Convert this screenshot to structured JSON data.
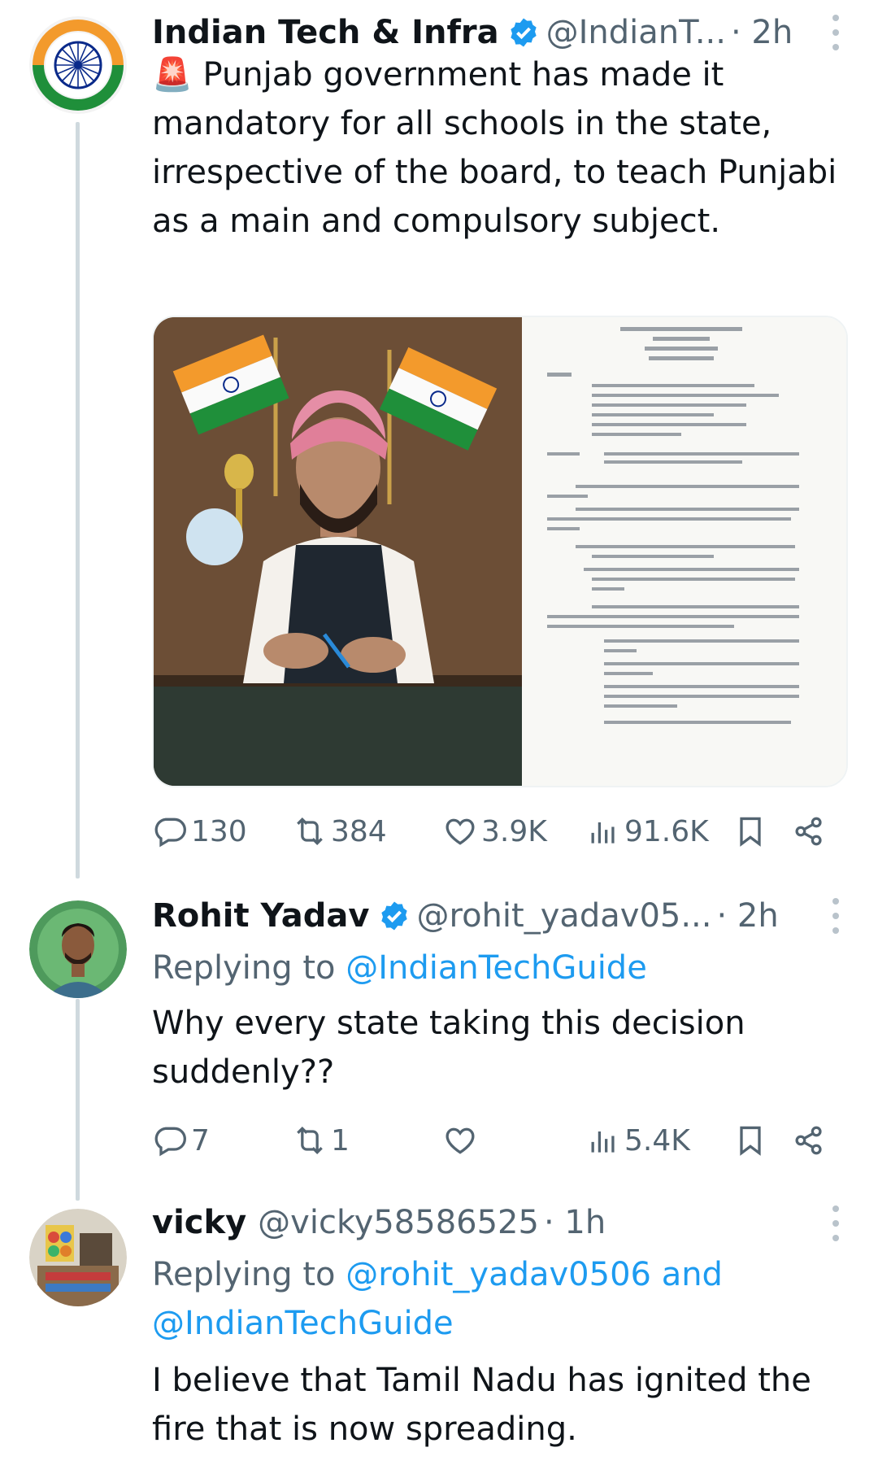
{
  "tweets": [
    {
      "name": "Indian Tech & Infra",
      "handle": "@IndianT...",
      "time": "· 2h",
      "text": "🚨 Punjab government has made it mandatory for all schools in the state, irrespective of the board, to teach Punjabi as a main and compulsory subject.",
      "stats": {
        "replies": "130",
        "reposts": "384",
        "likes": "3.9K",
        "views": "91.6K"
      }
    },
    {
      "name": "Rohit Yadav",
      "handle": "@rohit_yadav05...",
      "time": "· 2h",
      "replying_label": "Replying to ",
      "replying_to": "@IndianTechGuide",
      "text": "Why every state taking this decision suddenly??",
      "stats": {
        "replies": "7",
        "reposts": "1",
        "likes": "",
        "views": "5.4K"
      }
    },
    {
      "name": "vicky",
      "handle": "@vicky58586525",
      "time": "· 1h",
      "replying_label": "Replying to ",
      "replying_to": "@rohit_yadav0506 and @IndianTechGuide",
      "text": "I believe that Tamil Nadu has ignited the fire that is now spreading."
    }
  ],
  "icons": [
    "verified-badge-icon",
    "more-icon",
    "reply-icon",
    "repost-icon",
    "like-icon",
    "views-icon",
    "bookmark-icon",
    "share-icon"
  ],
  "colors": {
    "accent": "#1d9bf0",
    "secondary_text": "#536471",
    "thread_line": "#cfd9de"
  }
}
